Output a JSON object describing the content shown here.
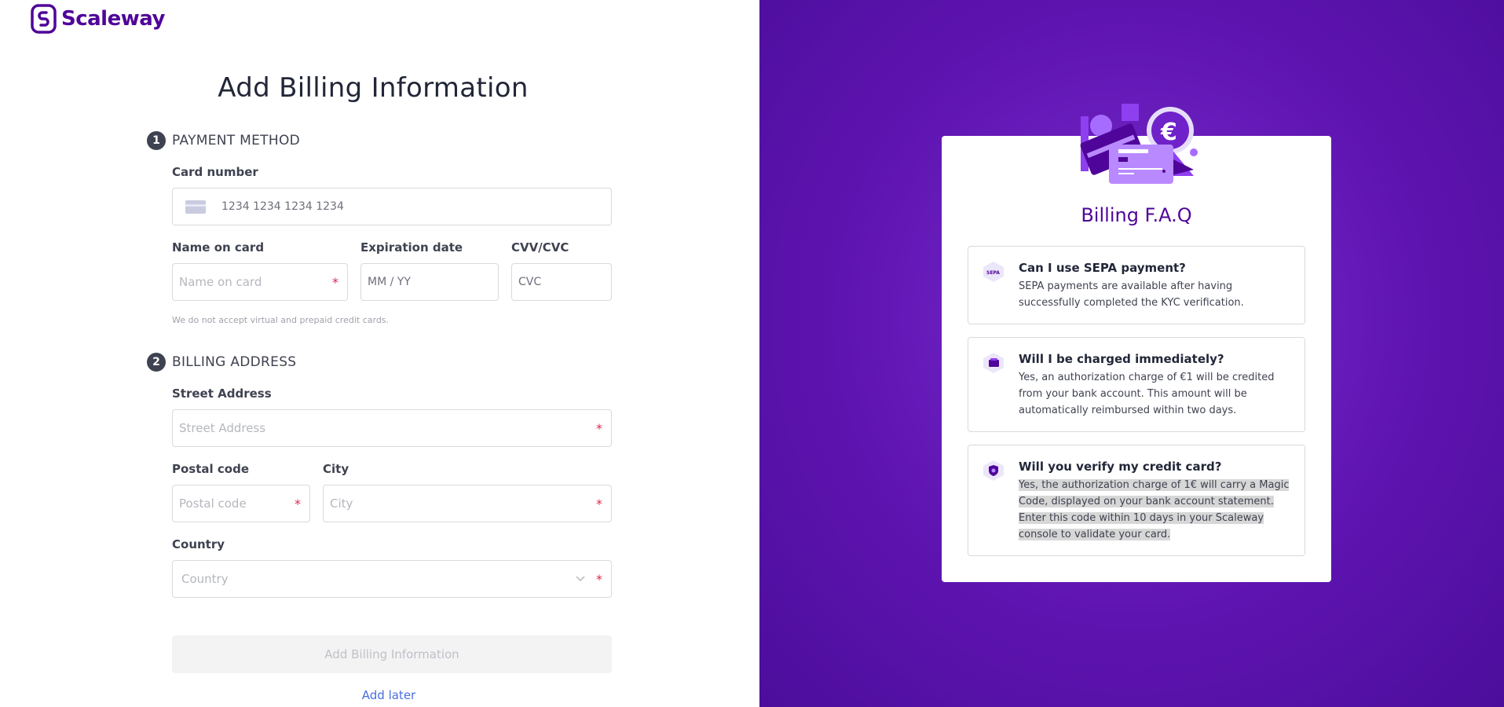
{
  "brand": {
    "name": "Scaleway"
  },
  "page": {
    "title": "Add Billing Information"
  },
  "payment": {
    "step_number": "1",
    "step_title": "PAYMENT METHOD",
    "card_number_label": "Card number",
    "card_number_placeholder": "1234 1234 1234 1234",
    "name_label": "Name on card",
    "name_placeholder": "Name on card",
    "expiry_label": "Expiration date",
    "expiry_placeholder": "MM / YY",
    "cvc_label": "CVV/CVC",
    "cvc_placeholder": "CVC",
    "note": "We do not accept virtual and prepaid credit cards."
  },
  "billing": {
    "step_number": "2",
    "step_title": "BILLING ADDRESS",
    "street_label": "Street Address",
    "street_placeholder": "Street Address",
    "postal_label": "Postal code",
    "postal_placeholder": "Postal code",
    "city_label": "City",
    "city_placeholder": "City",
    "country_label": "Country",
    "country_placeholder": "Country"
  },
  "required_mark": "*",
  "actions": {
    "submit_label": "Add Billing Information",
    "later_label": "Add later"
  },
  "faq": {
    "title": "Billing F.A.Q",
    "items": [
      {
        "question": "Can I use SEPA payment?",
        "answer": "SEPA payments are available after having successfully completed the KYC verification.",
        "icon": "sepa-icon"
      },
      {
        "question": "Will I be charged immediately?",
        "answer": "Yes, an authorization charge of €1 will be credited from your bank account. This amount will be automatically reimbursed within two days.",
        "icon": "wallet-icon"
      },
      {
        "question": "Will you verify my credit card?",
        "answer": "Yes, the authorization charge of 1€ will carry a Magic Code, displayed on your bank account statement. Enter this code within 10 days in your Scaleway console to validate your card.",
        "icon": "shield-icon"
      }
    ]
  },
  "colors": {
    "brand_purple": "#4f0599",
    "panel_purple": "#5e14b0",
    "required_red": "#e4254f",
    "link_blue": "#4a6ee0"
  }
}
